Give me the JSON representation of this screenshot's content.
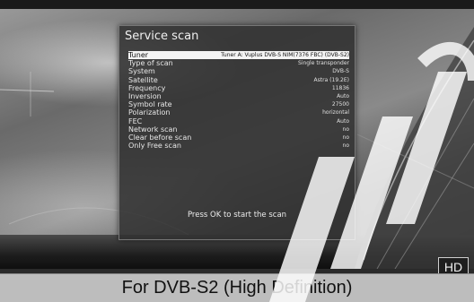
{
  "dialog": {
    "title": "Service scan",
    "rows": [
      {
        "label": "Tuner",
        "value": "Tuner A: Vuplus DVB-S NIM(7376 FBC) (DVB-S2)"
      },
      {
        "label": "Type of scan",
        "value": "Single transponder"
      },
      {
        "label": "System",
        "value": "DVB-S"
      },
      {
        "label": "Satellite",
        "value": "Astra (19.2E)"
      },
      {
        "label": "Frequency",
        "value": "11836"
      },
      {
        "label": "Inversion",
        "value": "Auto"
      },
      {
        "label": "Symbol rate",
        "value": "27500"
      },
      {
        "label": "Polarization",
        "value": "horizontal"
      },
      {
        "label": "FEC",
        "value": "Auto"
      },
      {
        "label": "Network scan",
        "value": "no"
      },
      {
        "label": "Clear before scan",
        "value": "no"
      },
      {
        "label": "Only Free scan",
        "value": "no"
      }
    ],
    "selected_index": 0,
    "hint": "Press OK to start the scan"
  },
  "badge": "HD",
  "caption": "For DVB-S2 (High Definition)"
}
